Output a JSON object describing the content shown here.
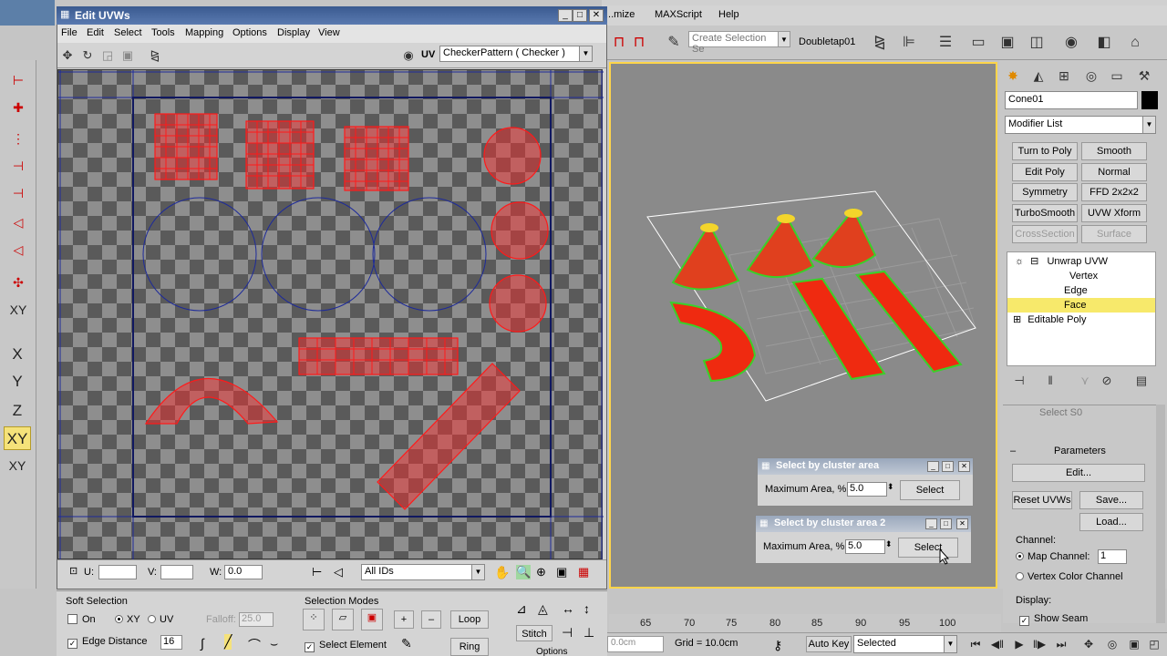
{
  "max": {
    "menu": [
      "...mize",
      "MAXScript",
      "Help"
    ],
    "selection_set_placeholder": "Create Selection Se",
    "snap_name": "Doubletap01",
    "axis_buttons": [
      "X",
      "Y",
      "Z",
      "XY",
      "XY"
    ],
    "object_name": "Cone01",
    "modifier_list": "Modifier List",
    "modifier_buttons": [
      "Turn to Poly",
      "Smooth",
      "Edit Poly",
      "Normal",
      "Symmetry",
      "FFD 2x2x2",
      "TurboSmooth",
      "UVW Xform",
      "CrossSection",
      "Surface"
    ],
    "stack": {
      "unwrap": "Unwrap UVW",
      "vertex": "Vertex",
      "edge": "Edge",
      "face": "Face",
      "editable_poly": "Editable Poly"
    },
    "params": {
      "header": "Parameters",
      "edit": "Edit...",
      "reset": "Reset UVWs",
      "save": "Save...",
      "load": "Load...",
      "channel_label": "Channel:",
      "map_channel": "Map Channel:",
      "map_channel_value": "1",
      "vertex_color_channel": "Vertex Color Channel",
      "display_label": "Display:",
      "show_seam": "Show Seam",
      "select_s0": "Select S0"
    },
    "trackbar_ticks": [
      "65",
      "70",
      "75",
      "80",
      "85",
      "90",
      "95",
      "100"
    ],
    "cm_field": "0.0cm",
    "grid": "Grid = 10.0cm",
    "auto_key": "Auto Key",
    "selected": "Selected"
  },
  "uvw": {
    "title": "Edit UVWs",
    "menu": [
      "File",
      "Edit",
      "Select",
      "Tools",
      "Mapping",
      "Options",
      "Display",
      "View"
    ],
    "uv_label": "UV",
    "checker": "CheckerPattern  ( Checker )",
    "u_label": "U:",
    "v_label": "V:",
    "w_label": "W:",
    "w_value": "0.0",
    "ids": "All IDs",
    "soft_selection": "Soft Selection",
    "on": "On",
    "xy": "XY",
    "uv": "UV",
    "falloff": "Falloff:",
    "falloff_value": "25.0",
    "edge_distance": "Edge Distance",
    "edge_distance_value": "16",
    "selection_modes": "Selection Modes",
    "loop": "Loop",
    "ring": "Ring",
    "stitch": "Stitch",
    "select_element": "Select Element",
    "options": "Options"
  },
  "dialogs": [
    {
      "title": "Select by cluster area",
      "label": "Maximum Area, %",
      "value": "5.0",
      "button": "Select"
    },
    {
      "title": "Select by cluster area 2",
      "label": "Maximum Area, %",
      "value": "5.0",
      "button": "Select"
    }
  ],
  "colors": {
    "uv_red": "#ff1a1a",
    "viewport_bg": "#8a8a8a",
    "active_yellow": "#ffd54a",
    "face_highlight": "#f7e96b"
  }
}
